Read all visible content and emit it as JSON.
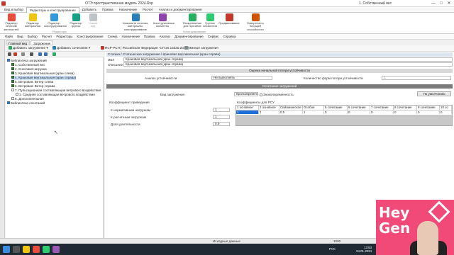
{
  "window": {
    "title": "ОТЭ пространственная модель 2024.Rsp",
    "right_text": "1. Собственный вес",
    "buttons": [
      "—",
      "□",
      "✕"
    ]
  },
  "ribbon_tabs": [
    "Вид и выбор",
    "Редакторы и конструирование",
    "Добавить",
    "Правка",
    "Назначение",
    "Расчет",
    "Анализ и документирование"
  ],
  "ribbon_buttons": [
    {
      "label": "Редактор сечений/ жесткостей",
      "color": "#e74c3c"
    },
    {
      "label": "Редактор материалов",
      "color": "#f1c40f"
    },
    {
      "label": "Редактор конструирования",
      "color": "#3498db"
    },
    {
      "label": "Редактор группы",
      "color": "#16a085"
    },
    {
      "label": "Новый вид",
      "color": "#bdc3c7"
    },
    {
      "label": "Назначить сечения, материалы, конструирование",
      "color": "#2980b9"
    },
    {
      "label": "Конструктивные элементы",
      "color": "#8e44ad"
    },
    {
      "label": "Раскрепление для прогибов",
      "color": "#27ae60"
    },
    {
      "label": "Группы элементов",
      "color": "#2ecc71"
    },
    {
      "label": "Продавливание",
      "color": "#c0392b"
    },
    {
      "label": "Поверхность несущей способности",
      "color": "#d35400"
    }
  ],
  "ribbon_groups": [
    "Редакторы",
    "Конструирование"
  ],
  "menu": [
    "Файл",
    "Вид",
    "Выбор",
    "Расчет",
    "Редакторы",
    "Конструирование",
    "Схема",
    "Назначение",
    "Правка",
    "Анализ",
    "Документирование",
    "Сервис",
    "Справка"
  ],
  "doc_tabs": [
    "Главный вид",
    "Загружения"
  ],
  "toolbar": {
    "add_load": "Добавить загружение ▾",
    "add_combo": "Добавить сочетание ▾",
    "code": "RCP-PCH | Российская Федерация -СП 20.13330.2016 |",
    "import": "Импорт загружения"
  },
  "tree": {
    "root": "Библиотека загружений",
    "items": [
      {
        "label": "1. Собственный вес",
        "checked": true
      },
      {
        "label": "2. Снеговая нагрузка",
        "checked": true
      },
      {
        "label": "3. Крановая вертикальная (кран слева)",
        "checked": true
      },
      {
        "label": "4. Крановая вертикальная (кран справа)",
        "checked": true,
        "selected": true
      },
      {
        "label": "5. Ветровая. Ветер слева",
        "checked": true
      },
      {
        "label": "6. Ветровая. Ветер справа",
        "checked": true
      },
      {
        "label": "7. Пульсационная составляющая ветрового воздействия",
        "checked": false
      },
      {
        "label": "1. Средняя составляющая ветрового воздействия",
        "checked": false
      },
      {
        "label": "8. Дополнительная",
        "checked": false
      }
    ],
    "combos": "Библиотека сочетаний"
  },
  "form": {
    "crumb": "Статика / Статическое загружение / Крановая вертикальная (кран справа)",
    "name_label": "Имя",
    "name_value": "Крановая вертикальная (кран справа)",
    "desc_label": "Описание",
    "desc_value": "Крановая вертикальная (кран справа)",
    "stability_head": "Оценка начальной потери устойчивости",
    "stability_label": "Анализ устойчивости",
    "stability_value": "Не выполнять",
    "forms_label": "Количество форм потери устойчивости",
    "forms_value": "1",
    "combo_head": "Сочетание загружений",
    "load_type_label": "Вид загружения",
    "load_type_value": "Кратковременное",
    "sign_var": "Знакопеременность",
    "default_btn": "По умолчанию",
    "coef_head": "Коэффициент приведения",
    "norm_label": "К нормативным нагрузкам",
    "norm_value": "1",
    "calc_label": "К расчетным нагрузкам",
    "calc_value": "1",
    "duration_label": "Доля длительности",
    "duration_value": "0.6",
    "rsu_head": "Коэффициенты для РСУ"
  },
  "rsu_grid": {
    "headers": [
      "1 основное",
      "2 основное",
      "Сейсмическое",
      "Особое",
      "5 сочетание",
      "6 сочетание",
      "7 сочетание",
      "8 сочетание",
      "9 сочетание",
      "10 со"
    ],
    "values": [
      "1",
      "1",
      "0.5",
      "1",
      "0",
      "0",
      "0",
      "0",
      "0",
      "0"
    ]
  },
  "status": {
    "left": "Исходные данные",
    "right": "1000"
  },
  "taskbar": {
    "time": "13:53",
    "date": "24.01.2024",
    "lang": "РУС"
  },
  "watermark": {
    "line1": "Hey",
    "line2": "Gen"
  }
}
